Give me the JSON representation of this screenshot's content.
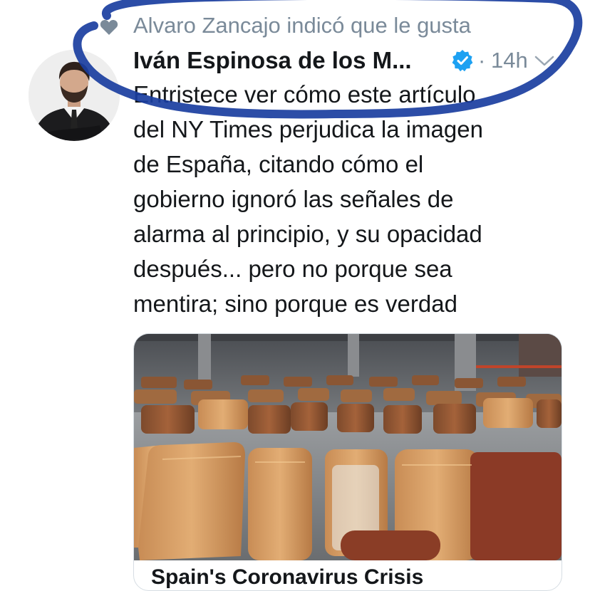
{
  "social_context": {
    "icon": "heart-icon",
    "text": "Alvaro Zancajo indicó que le gusta"
  },
  "author": {
    "name": "Iván Espinosa de los M...",
    "verified": true,
    "separator": "·",
    "time": "14h"
  },
  "tweet": {
    "lines": [
      "Entristece ver cómo este artículo",
      "del NY Times perjudica la imagen",
      "de España, citando cómo el",
      "gobierno ignoró las señales de",
      "alarma al principio, y su opacidad",
      "después... pero no porque sea",
      "mentira; sino porque es verdad"
    ]
  },
  "card": {
    "title_partial": "Spain's Coronavirus Crisis"
  },
  "colors": {
    "text": "#14171a",
    "muted": "#7a8a99",
    "verified_blue": "#1da1f2",
    "annotation_blue": "#1a3ea0"
  }
}
